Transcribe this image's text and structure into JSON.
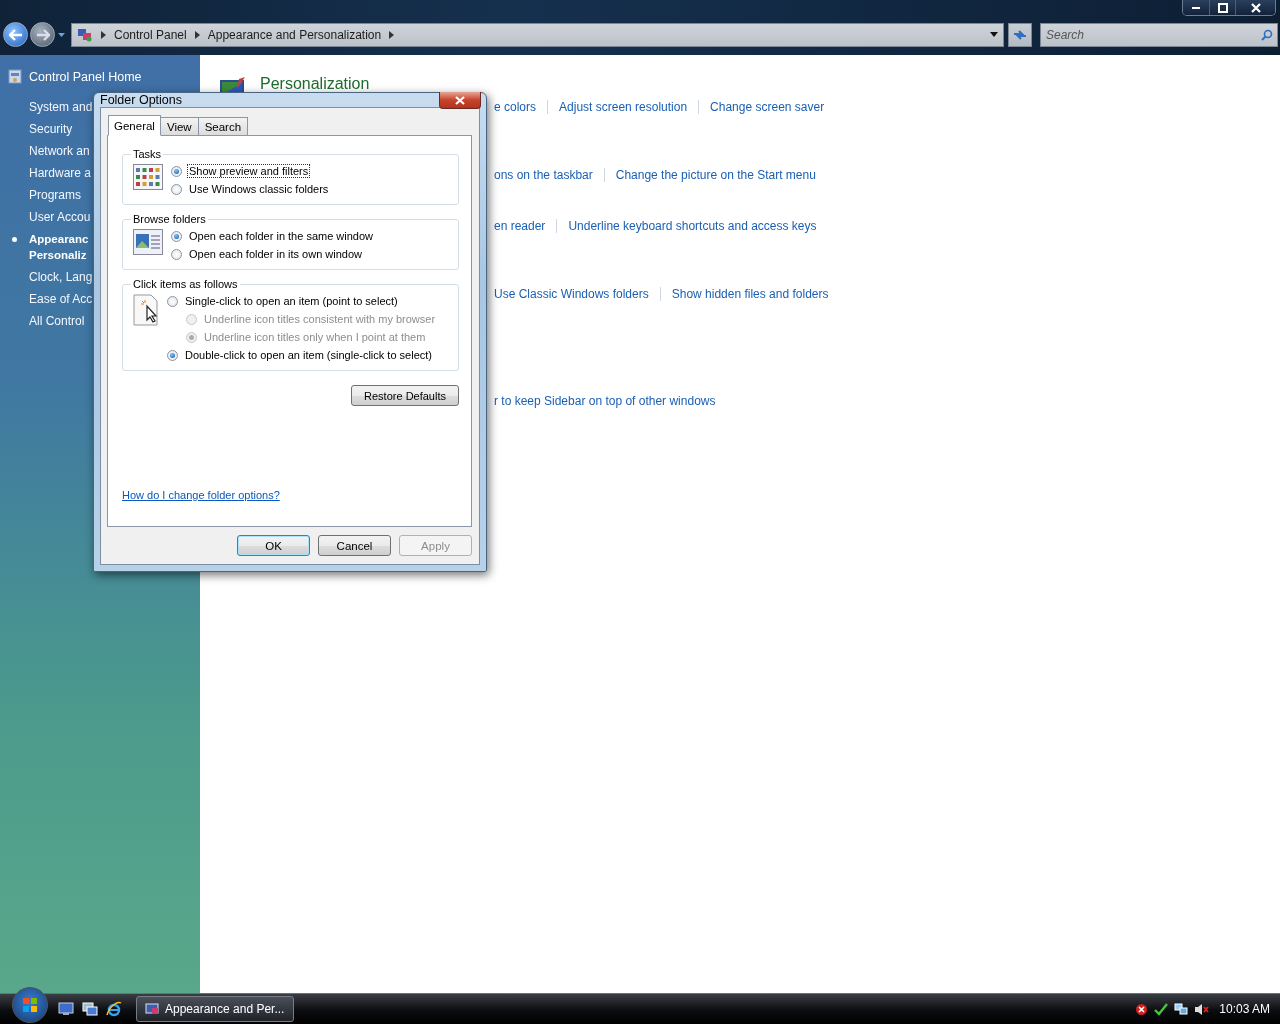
{
  "address_bar": {
    "crumbs": [
      "Control Panel",
      "Appearance and Personalization"
    ]
  },
  "search": {
    "placeholder": "Search"
  },
  "sidebar": {
    "home": "Control Panel Home",
    "items": [
      {
        "lines": [
          "System and"
        ],
        "selected": false
      },
      {
        "lines": [
          "Security"
        ],
        "selected": false
      },
      {
        "lines": [
          "Network an"
        ],
        "selected": false
      },
      {
        "lines": [
          "Hardware a"
        ],
        "selected": false
      },
      {
        "lines": [
          "Programs"
        ],
        "selected": false
      },
      {
        "lines": [
          "User Accou"
        ],
        "selected": false
      },
      {
        "lines": [
          "Appearanc",
          "Personaliz"
        ],
        "selected": true
      },
      {
        "lines": [
          "Clock, Lang"
        ],
        "selected": false
      },
      {
        "lines": [
          "Ease of Acc"
        ],
        "selected": false
      },
      {
        "lines": [
          "All Control"
        ],
        "selected": false
      }
    ]
  },
  "content": {
    "heading": "Personalization",
    "rows": [
      {
        "links": [
          "e colors",
          "Adjust screen resolution",
          "Change screen saver"
        ]
      },
      {
        "links": [
          "ons on the taskbar",
          "Change the picture on the Start menu"
        ]
      },
      {
        "links": [
          "en reader",
          "Underline keyboard shortcuts and access keys"
        ]
      },
      {
        "links": [
          "Use Classic Windows folders",
          "Show hidden files and folders"
        ]
      },
      {
        "links": [
          "r to keep Sidebar on top of other windows"
        ]
      }
    ]
  },
  "dialog": {
    "title": "Folder Options",
    "tabs": [
      {
        "label": "General",
        "selected": true
      },
      {
        "label": "View",
        "selected": false
      },
      {
        "label": "Search",
        "selected": false
      }
    ],
    "groups": [
      {
        "kind": "tasks",
        "title": "Tasks",
        "options": [
          {
            "label": "Show preview and filters",
            "selected": true,
            "disabled": false,
            "focused": true
          },
          {
            "label": "Use Windows classic folders",
            "selected": false,
            "disabled": false,
            "focused": false
          }
        ]
      },
      {
        "kind": "browse",
        "title": "Browse folders",
        "options": [
          {
            "label": "Open each folder in the same window",
            "selected": true,
            "disabled": false,
            "focused": false
          },
          {
            "label": "Open each folder in its own window",
            "selected": false,
            "disabled": false,
            "focused": false
          }
        ]
      },
      {
        "kind": "click",
        "title": "Click items as follows",
        "options": [
          {
            "label": "Single-click to open an item (point to select)",
            "selected": false,
            "disabled": false,
            "focused": false,
            "children": [
              {
                "label": "Underline icon titles consistent with my browser",
                "selected": false,
                "disabled": true,
                "focused": false
              },
              {
                "label": "Underline icon titles only when I point at them",
                "selected": true,
                "disabled": true,
                "focused": false
              }
            ]
          },
          {
            "label": "Double-click to open an item (single-click to select)",
            "selected": true,
            "disabled": false,
            "focused": false
          }
        ]
      }
    ],
    "restore_button": "Restore Defaults",
    "help_link": "How do I change folder options?",
    "buttons": [
      {
        "label": "OK",
        "default": true,
        "disabled": false
      },
      {
        "label": "Cancel",
        "default": false,
        "disabled": false
      },
      {
        "label": "Apply",
        "default": false,
        "disabled": true
      }
    ]
  },
  "taskbar": {
    "task": "Appearance and Per...",
    "clock": "10:03 AM"
  }
}
